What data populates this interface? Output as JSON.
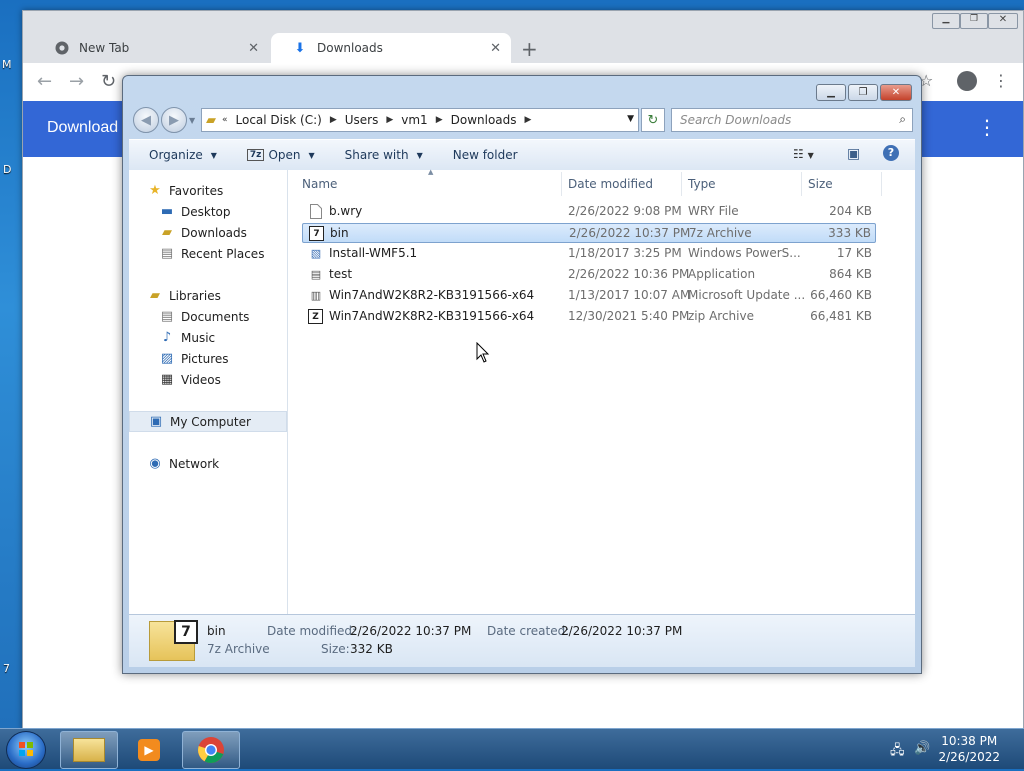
{
  "desktop": {
    "edge_letters": [
      "M",
      "D",
      "7"
    ]
  },
  "chrome": {
    "tabs": [
      {
        "label": "New Tab",
        "icon": "chrome-icon",
        "active": false
      },
      {
        "label": "Downloads",
        "icon": "download-icon",
        "active": true
      }
    ],
    "page_title": "Download"
  },
  "explorer": {
    "address": [
      "Local Disk (C:)",
      "Users",
      "vm1",
      "Downloads"
    ],
    "search_placeholder": "Search Downloads",
    "commands": {
      "organize": "Organize",
      "open": "Open",
      "share": "Share with",
      "new_folder": "New folder"
    },
    "nav": {
      "favorites": "Favorites",
      "favorites_items": [
        "Desktop",
        "Downloads",
        "Recent Places"
      ],
      "libraries": "Libraries",
      "libraries_items": [
        "Documents",
        "Music",
        "Pictures",
        "Videos"
      ],
      "computer": "My Computer",
      "network": "Network"
    },
    "columns": {
      "name": "Name",
      "date": "Date modified",
      "type": "Type",
      "size": "Size"
    },
    "files": [
      {
        "name": "b.wry",
        "date": "2/26/2022 9:08 PM",
        "type": "WRY File",
        "size": "204 KB",
        "icon": "blank-file-icon"
      },
      {
        "name": "bin",
        "date": "2/26/2022 10:37 PM",
        "type": "7z Archive",
        "size": "333 KB",
        "icon": "7z-archive-icon",
        "selected": true
      },
      {
        "name": "Install-WMF5.1",
        "date": "1/18/2017 3:25 PM",
        "type": "Windows PowerS...",
        "size": "17 KB",
        "icon": "script-icon"
      },
      {
        "name": "test",
        "date": "2/26/2022 10:36 PM",
        "type": "Application",
        "size": "864 KB",
        "icon": "application-icon"
      },
      {
        "name": "Win7AndW2K8R2-KB3191566-x64",
        "date": "1/13/2017 10:07 AM",
        "type": "Microsoft Update ...",
        "size": "66,460 KB",
        "icon": "update-package-icon"
      },
      {
        "name": "Win7AndW2K8R2-KB3191566-x64",
        "date": "12/30/2021 5:40 PM",
        "type": "zip Archive",
        "size": "66,481 KB",
        "icon": "zip-archive-icon"
      }
    ],
    "details": {
      "name": "bin",
      "type": "7z Archive",
      "date_modified_label": "Date modified:",
      "date_modified": "2/26/2022 10:37 PM",
      "date_created_label": "Date created:",
      "date_created": "2/26/2022 10:37 PM",
      "size_label": "Size:",
      "size": "332 KB"
    }
  },
  "taskbar": {
    "time": "10:38 PM",
    "date": "2/26/2022"
  },
  "colors": {
    "chrome_header": "#3367d6",
    "selection": "#c1dcf8",
    "taskbar": "#1e4a78"
  }
}
